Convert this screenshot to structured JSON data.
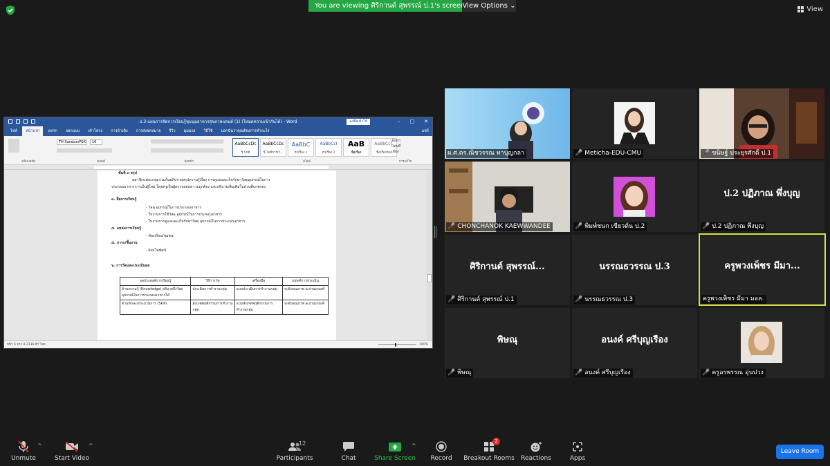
{
  "banner": {
    "viewing_text": "You are viewing ศิริกานต์ สุพรรณ์ ป.1's screen",
    "view_options": "View Options",
    "view_label": "View"
  },
  "word": {
    "title": "ป.3-แผนการจัดการเรียนรู้ชุมนุมอาหารสุขภาพแลนด์ (1) (โหมดความเข้ากันได้) - Word",
    "signin": "ลงชื่อเข้าใช้",
    "tabs": [
      "ไฟล์",
      "หน้าแรก",
      "แทรก",
      "ออกแบบ",
      "เค้าโครง",
      "การอ้างอิง",
      "การส่งจดหมาย",
      "รีวิว",
      "มุมมอง",
      "วิธีใช้",
      "บอกฉันว่าคุณต้องการทำอะไร"
    ],
    "share": "แชร์",
    "font": "TH SarabunPSK",
    "size": "16",
    "styles": [
      {
        "sample": "AaBbCcDc",
        "name": "¶ ปกติ"
      },
      {
        "sample": "AaBbCcDc",
        "name": "¶ ไม่มีการเว้..."
      },
      {
        "sample": "AaBbC",
        "name": "หัวเรื่อง 1"
      },
      {
        "sample": "AaBbCcI",
        "name": "หัวเรื่อง 2"
      },
      {
        "sample": "AaB",
        "name": "ชื่อเรื่อง"
      },
      {
        "sample": "AaBbCcC",
        "name": "ชื่อเรื่องรอง"
      }
    ],
    "ribbon_groups": [
      "คลิปบอร์ด",
      "ฟอนต์",
      "ย่อหน้า",
      "สไตล์",
      "การแก้ไข"
    ],
    "edit_tools": [
      "ค้นหา",
      "แทนที่",
      "เลือก"
    ],
    "doc_lines": [
      "ขั้นที่ ๓ สรุป",
      "สมาชิกแต่ละกลุ่มร่วมกันอภิปรายสรุปความรู้เรื่อง การดูแลและเก็บรักษาวัสดุอุปกรณ์ในการ",
      "ประกอบอาหารการเป็นผู้ใหม่ โดยครูเป็นผู้ตรวจสอบความถูกต้อง และอธิบายเพิ่มเติมในส่วนที่บกพร่อง",
      "๓. สื่อการเรียนรู้",
      "- วัสดุ อุปกรณ์ในการประกอบอาหาร",
      "- ใบงานการใช้วัสดุ อุปกรณ์ในการประกอบอาหาร",
      "- ใบงานการดูแลและเก็บรักษาวัสดุ อุปกรณ์ในการประกอบอาหาร",
      "๔. แหล่งการเรียนรู้",
      "- ห้องเรียน/ชุมชน",
      "๕. ภาระ/ชิ้นงาน",
      "- ผังมโนทัศน์",
      "๖. การวัดและประเมินผล"
    ],
    "table": {
      "headers": [
        "จุดประสงค์การเรียนรู้",
        "วิธีการวัด",
        "เครื่องมือ",
        "เกณฑ์การประเมิน"
      ],
      "rows": [
        [
          "ด้านความรู้ (Knowledge) อธิบายถึงวัสดุ อุปกรณ์ในการประกอบอาหารได้",
          "ประเมินการทำงานกลุ่ม",
          "แบบประเมินการทำงานกลุ่ม",
          "ระดับคุณภาพ ๒ ผ่านเกณฑ์"
        ],
        [
          "ด้านทักษะ/กระบวนการ (Skill)",
          "สังเกตพฤติกรรมการทำงานกลุ่ม",
          "แบบสังเกตพฤติกรรมการทำงานกลุ่ม",
          "ระดับคุณภาพ ๒ ผ่านเกณฑ์"
        ]
      ]
    },
    "status_left": "หน้า 6 จาก 8     2136 คำ     ไทย",
    "zoom": "100%"
  },
  "participants": [
    {
      "name": "ผ.ศ.ดร.ณิชวรรณ ทาบุญกลา",
      "video": true,
      "muted": false
    },
    {
      "name": "Meticha-EDU-CMU",
      "video": true,
      "muted": true
    },
    {
      "name": "ขนิษฐ์ ประยุรศักดิ์ ป.1",
      "video": true,
      "muted": true
    },
    {
      "name": "CHONCHANOK KAEWWANDEE",
      "video": true,
      "muted": true
    },
    {
      "name": "พิมพ์ชนก เขียวต้น ป.2",
      "video": true,
      "muted": true
    },
    {
      "name": "ป.2 ปฏิภาณ พึ่งบุญ",
      "big": "ป.2 ปฏิภาณ พึ่งบุญ",
      "video": false,
      "muted": true
    },
    {
      "name": "ศิริกานต์ สุพรรณ์ ป.1",
      "big": "ศิริกานต์ สุพรรณ์...",
      "video": false,
      "muted": true
    },
    {
      "name": "นรรณธวรรณ ป.3",
      "big": "นรรณธวรรณ ป.3",
      "video": false,
      "muted": true
    },
    {
      "name": "ครูพวงเพ็ชร มีมา มอล.",
      "big": "ครูพวงเพ็ชร มีมา...",
      "video": false,
      "muted": false,
      "active": true
    },
    {
      "name": "พิษณุ",
      "big": "พิษณุ",
      "video": false,
      "muted": true
    },
    {
      "name": "อนงค์ ศรีบุญเรือง",
      "big": "อนงค์ ศรีบุญเรือง",
      "video": false,
      "muted": true
    },
    {
      "name": "ครูอรพรรณ อุ่นปวง",
      "video": true,
      "muted": true
    }
  ],
  "toolbar": {
    "unmute": "Unmute",
    "start_video": "Start Video",
    "participants": "Participants",
    "participants_count": "12",
    "chat": "Chat",
    "share_screen": "Share Screen",
    "record": "Record",
    "breakout_rooms": "Breakout Rooms",
    "breakout_badge": "2",
    "reactions": "Reactions",
    "apps": "Apps",
    "leave": "Leave Room"
  },
  "colors": {
    "accent_green": "#26a745",
    "leave_blue": "#1a73e8",
    "active_speaker": "#d7e04a",
    "word_blue": "#2b579a"
  }
}
